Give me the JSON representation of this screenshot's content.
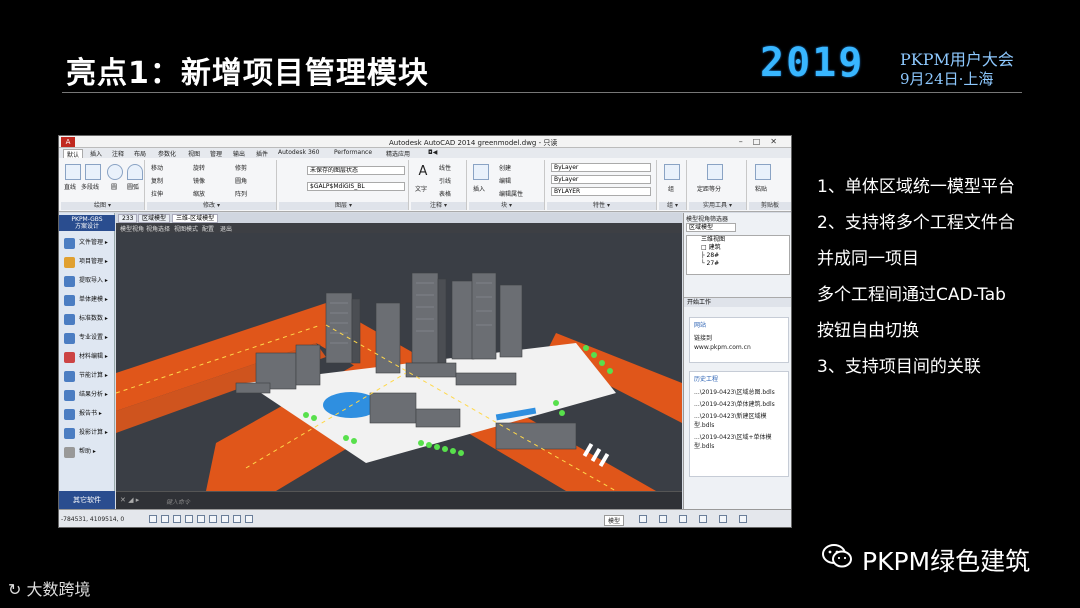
{
  "slide": {
    "title": "亮点1：新增项目管理模块",
    "conference": {
      "year": "2019",
      "name": "PKPM用户大会",
      "date": "9月24日·上海"
    },
    "bullets": [
      "1、单体区域统一模型平台",
      "2、支持将多个工程文件合",
      "并成同一项目",
      "多个工程间通过CAD-Tab",
      "按钮自由切换",
      "3、支持项目间的关联"
    ],
    "footer": {
      "wechat_account": "PKPM绿色建筑",
      "logo_text": "大数跨境"
    }
  },
  "cad": {
    "window_title": "Autodesk AutoCAD 2014    greenmodel.dwg - 只读",
    "app_logo": "A",
    "ribbon_tabs": [
      "默认",
      "插入",
      "注释",
      "布局",
      "参数化",
      "视图",
      "管理",
      "输出",
      "插件",
      "Autodesk 360",
      "Performance",
      "精选应用",
      "◘◀"
    ],
    "ribbon_groups": [
      {
        "label": "绘图 ▾",
        "items": [
          "直线",
          "多段线",
          "圆",
          "圆弧"
        ]
      },
      {
        "label": "修改 ▾",
        "items": [
          "移动",
          "旋转",
          "修剪",
          "复制",
          "镜像",
          "圆角",
          "拉伸",
          "缩放",
          "阵列"
        ]
      },
      {
        "label": "图层 ▾",
        "items": [
          "未保存的图层状态",
          "$GALP$MdiGIS_BL"
        ]
      },
      {
        "label": "注释 ▾",
        "items": [
          "文字",
          "线性",
          "引线",
          "表格"
        ]
      },
      {
        "label": "块 ▾",
        "items": [
          "插入",
          "创建",
          "编辑",
          "编辑属性"
        ]
      },
      {
        "label": "特性 ▾",
        "items": [
          "ByLayer",
          "ByLayer",
          "BYLAYER"
        ]
      },
      {
        "label": "组 ▾",
        "items": [
          "组"
        ]
      },
      {
        "label": "实用工具 ▾",
        "items": [
          "测量",
          "定距等分"
        ]
      },
      {
        "label": "剪贴板",
        "items": [
          "粘贴"
        ]
      }
    ],
    "left_panel": {
      "header": "PKPM-GBS\n方案设计",
      "items": [
        "文件管理 ▸",
        "项目管理 ▸",
        "提取导入 ▸",
        "单体建模 ▸",
        "标准数数 ▸",
        "专业设置 ▸",
        "材料编辑 ▸",
        "节能计算 ▸",
        "结果分析 ▸",
        "报告书 ▸",
        "投影计算 ▸",
        "帮助 ▸"
      ],
      "footer": "其它软件"
    },
    "doc_tabs": [
      "233",
      "区域模型",
      "三维-区域模型"
    ],
    "view_toolbar": [
      "模型视角",
      "视角选择",
      "视图模式",
      "配置",
      "退出"
    ],
    "command_placeholder": "键入命令",
    "status": {
      "coords": "-784531, 4109514, 0",
      "model": "模型"
    },
    "right_panel": {
      "filter_title": "模型视角筛选器",
      "filter_combo": "区域模型",
      "tree": [
        "三维视图",
        "□ 建筑",
        "├ 28#",
        "└ 27#"
      ],
      "start_work": "开始工作",
      "website": {
        "heading": "网站",
        "lines": [
          "链接到",
          "www.pkpm.com.cn"
        ]
      },
      "history": {
        "heading": "历史工程",
        "files": [
          "...\\2019-0423\\区域总图.bdls",
          "...\\2019-0423\\单体建筑.bdls",
          "...\\2019-0423\\新建区域模型.bdls",
          "...\\2019-0423\\区域+单体模型.bdls"
        ]
      }
    }
  },
  "colors": {
    "accent_blue": "#38b6ff",
    "road_orange": "#e0561a",
    "grass_green": "#58e04c"
  }
}
